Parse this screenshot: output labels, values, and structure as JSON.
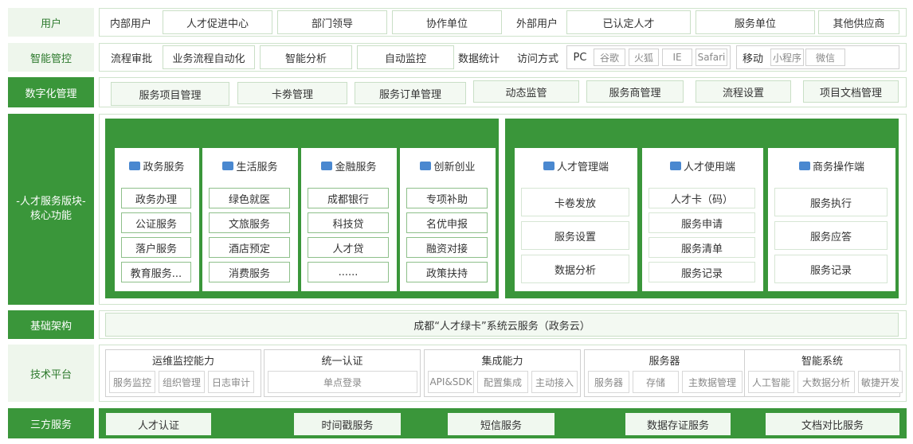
{
  "rows": {
    "users": {
      "label": "用户",
      "internal_label": "内部用户",
      "internal": [
        "人才促进中心",
        "部门领导",
        "协作单位"
      ],
      "external_label": "外部用户",
      "external": [
        "已认定人才",
        "服务单位",
        "其他供应商"
      ]
    },
    "smart_control": {
      "label": "智能管控",
      "flow_label": "流程审批",
      "flow": [
        "业务流程自动化",
        "智能分析",
        "自动监控"
      ],
      "stats": "数据统计",
      "access_label": "访问方式",
      "pc_label": "PC",
      "pc": [
        "谷歌",
        "火狐",
        "IE",
        "Safari"
      ],
      "mobile_label": "移动",
      "mobile": [
        "小程序",
        "微信"
      ]
    },
    "digital": {
      "label": "数字化管理",
      "items": [
        "服务项目管理",
        "卡劵管理",
        "服务订单管理",
        "动态监管",
        "服务商管理",
        "流程设置",
        "项目文档管理"
      ]
    },
    "core": {
      "label_line1": "-人才服务版块-",
      "label_line2": "核心功能",
      "left_cards": [
        {
          "title": "政务服务",
          "icon": "id-card-icon",
          "items": [
            "政务办理",
            "公证服务",
            "落户服务",
            "教育服务..."
          ]
        },
        {
          "title": "生活服务",
          "icon": "edit-icon",
          "items": [
            "绿色就医",
            "文旅服务",
            "酒店预定",
            "消费服务"
          ]
        },
        {
          "title": "金融服务",
          "icon": "briefcase-icon",
          "items": [
            "成都银行",
            "科技贷",
            "人才贷",
            "......"
          ]
        },
        {
          "title": "创新创业",
          "icon": "folder-icon",
          "items": [
            "专项补助",
            "名优申报",
            "融资对接",
            "政策扶持"
          ]
        }
      ],
      "right_cards": [
        {
          "title": "人才管理端",
          "icon": "user-manage-icon",
          "items": [
            "卡卷发放",
            "服务设置",
            "数据分析"
          ]
        },
        {
          "title": "人才使用端",
          "icon": "user-use-icon",
          "items": [
            "人才卡（码）",
            "服务申请",
            "服务清单",
            "服务记录"
          ]
        },
        {
          "title": "商务操作端",
          "icon": "monitor-icon",
          "items": [
            "服务执行",
            "服务应答",
            "服务记录"
          ]
        }
      ]
    },
    "infra": {
      "label": "基础架构",
      "content": "成都“人才绿卡”系统云服务（政务云）"
    },
    "tech": {
      "label": "技术平台",
      "groups": [
        {
          "title": "运维监控能力",
          "items": [
            "服务监控",
            "组织管理",
            "日志审计"
          ]
        },
        {
          "title": "统一认证",
          "items": [
            "单点登录"
          ]
        },
        {
          "title": "集成能力",
          "items": [
            "API&SDK",
            "配置集成",
            "主动接入"
          ]
        },
        {
          "title": "服务器",
          "items": [
            "服务器",
            "存储",
            "主数据管理"
          ]
        },
        {
          "title": "智能系统",
          "items": [
            "人工智能",
            "大数据分析",
            "敏捷开发"
          ]
        }
      ]
    },
    "third": {
      "label": "三方服务",
      "items": [
        "人才认证",
        "时间戳服务",
        "短信服务",
        "数据存证服务",
        "文档对比服务"
      ]
    }
  },
  "colors": {
    "primary_green": "#3a963a",
    "light_green": "#eef6ec",
    "icon_blue": "#4a88d0"
  }
}
